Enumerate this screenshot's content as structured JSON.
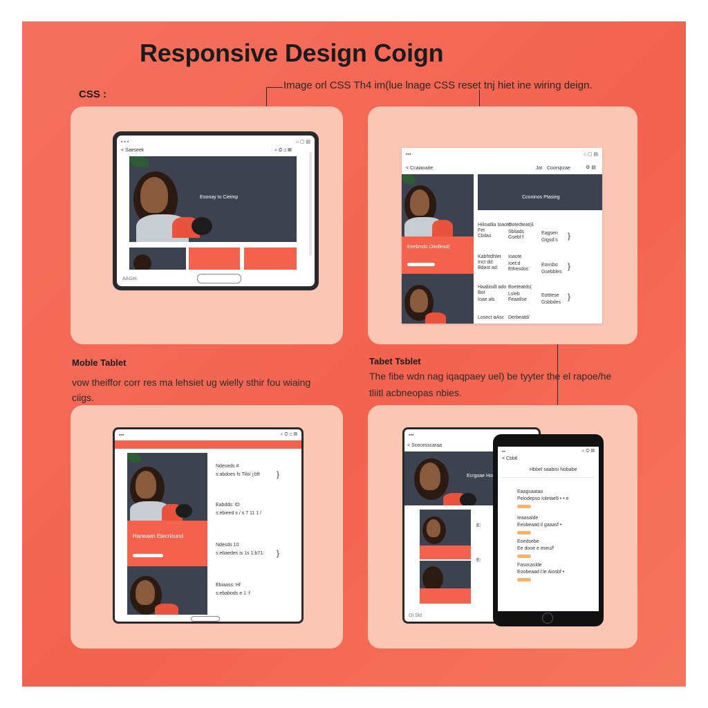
{
  "title": "Responsive Design Coign",
  "css_label": "CSS :",
  "callout_text": "Image orl CSS Th4 im(lue lnage CSS reset tnj hiet ine wiring deign.",
  "mobile_tablet": {
    "label": "Moble Tablet",
    "desc_line1": "vow theiffor corr res ma lehsiet ug wielly  sthir fou wiaing",
    "desc_line2": "ciigs."
  },
  "tablet_tablet": {
    "label": "Tabet Tsblet",
    "desc_line1": "The fibe wdn nag iqaqpaey uel) be tyyter the  el rapoe/he",
    "desc_line2": "tliitl acbneopas nbies."
  },
  "panel1": {
    "url": "< Saeseek",
    "hero_text": "Eoonay to Cieimp",
    "bottom_label": "AAGet"
  },
  "panel2": {
    "url": "< Ccaiaoaite",
    "nav1": "Jot",
    "nav2": "Coorspzae",
    "hero_text": "Cconinos Ptasieg",
    "coral_text": "Eeebmds Oiirdlead(",
    "rows": [
      {
        "a": "Hiiloatlia Ioaote",
        "b": "Ootedteat(£",
        "c": "Fet",
        "d": "Sbliads",
        "e": "Cbilas",
        "f": "Gsebl:f",
        "g": "Eagsen",
        "h": "Gigsd:s"
      },
      {
        "a": "Kabhtdhlet",
        "b": "Ioaote",
        "c": "Inct dd:",
        "d": "Ioet:d",
        "e": "Bdast ad:",
        "f": "Ethesdos",
        "g": "Eonsbo",
        "h": "Gsebbles"
      },
      {
        "a": "Haabisdt ado",
        "b": "Boeteatds(",
        "c": "Bot",
        "d": "Lsleb",
        "e": "Ioae als",
        "f": "Feaatlse",
        "g": "Eotttese",
        "h": "Gsbbdes"
      }
    ],
    "last_a": "Losect aAsc",
    "last_b": "Derbeatd/"
  },
  "panel3": {
    "hero_text": "Haneaen Etecriound",
    "rows": [
      {
        "a": "Ndeseds #",
        "b": "s:abdoes fs Tilo/ j:bft"
      },
      {
        "a": "Eabdds: tD",
        "b": "s:ebieed s / s 7 11 1 /"
      },
      {
        "a": "Ndesds 10",
        "b": "s:ebaedes is 1s 1:b71:"
      },
      {
        "a": "Ebiaass: Hf",
        "b": "s:ebabods e 1 :f"
      }
    ]
  },
  "panel4": {
    "url": "< Scecesscaraa",
    "hero_text": "Ecrgoae Hosieee",
    "bottom_label": "Ol Sld",
    "phone_url": "< Cbbtl",
    "phone_title": "Hbbel saabisi Nobabe",
    "phone_rows": [
      {
        "a": "Eaagsaatao",
        "b": "Pelodepso Ioletae9 • • e"
      },
      {
        "a": "Ieaasalde",
        "b": "Eeobeaad il gaaasf •"
      },
      {
        "a": "Eoedsebe",
        "b": "Ee dooe e eseu/f"
      },
      {
        "a": "Fasocaslde",
        "b": "Eoobeaad l:le Aiosbf •"
      }
    ]
  },
  "colors": {
    "background": "#f3634f",
    "panel": "#fbc6b4",
    "accent": "#f4614d",
    "dark": "#3d4250"
  }
}
